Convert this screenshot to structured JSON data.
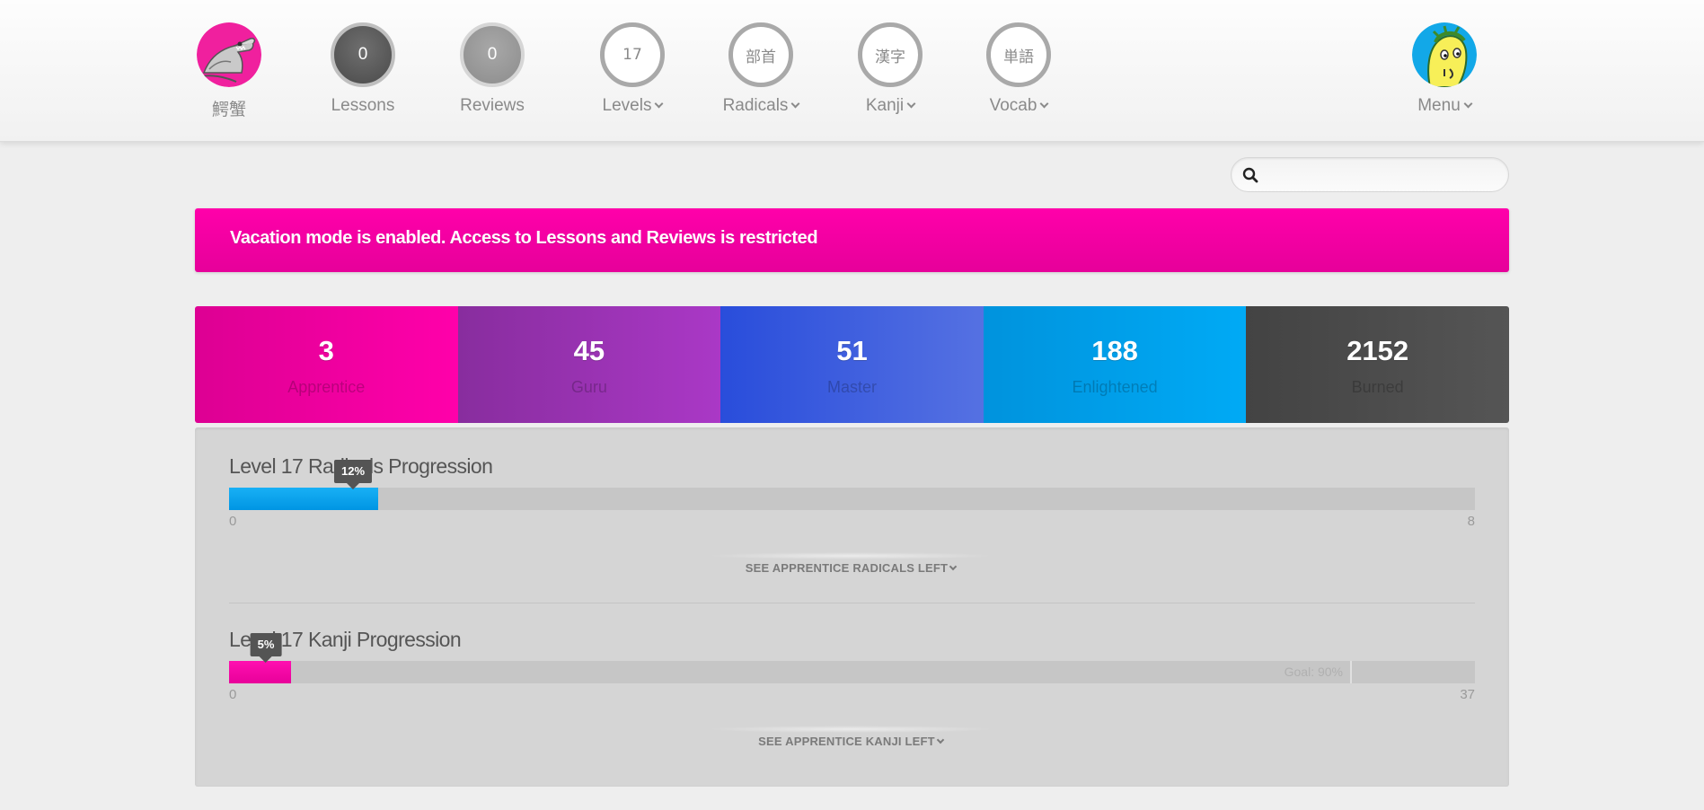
{
  "header": {
    "user": {
      "label": "鰐蟹"
    },
    "lessons": {
      "count": "0",
      "label": "Lessons"
    },
    "reviews": {
      "count": "0",
      "label": "Reviews"
    },
    "levels": {
      "value": "17",
      "label": "Levels"
    },
    "radicals": {
      "glyph": "部首",
      "label": "Radicals"
    },
    "kanji": {
      "glyph": "漢字",
      "label": "Kanji"
    },
    "vocab": {
      "glyph": "単語",
      "label": "Vocab"
    },
    "menu": {
      "label": "Menu"
    }
  },
  "search": {
    "placeholder": "",
    "icon": "search-icon"
  },
  "banner": {
    "text": "Vacation mode is enabled. Access to Lessons and Reviews is restricted"
  },
  "srs": [
    {
      "count": "3",
      "label": "Apprentice",
      "color": "#f100a1"
    },
    {
      "count": "45",
      "label": "Guru",
      "color": "#a13cbd"
    },
    {
      "count": "51",
      "label": "Master",
      "color": "#3f5fde"
    },
    {
      "count": "188",
      "label": "Enlightened",
      "color": "#00a0f1"
    },
    {
      "count": "2152",
      "label": "Burned",
      "color": "#4a4a4a"
    }
  ],
  "progress": {
    "radicals": {
      "title": "Level 17 Radicals Progression",
      "percent": 12,
      "percent_label": "12%",
      "min": "0",
      "max": "8",
      "color": "#00a2ef",
      "see_more": "SEE APPRENTICE RADICALS LEFT"
    },
    "kanji": {
      "title": "Level 17 Kanji Progression",
      "percent": 5,
      "percent_label": "5%",
      "min": "0",
      "max": "37",
      "goal_percent": 90,
      "goal_label": "Goal: 90%",
      "color": "#ee00a0",
      "see_more": "SEE APPRENTICE KANJI LEFT"
    }
  }
}
